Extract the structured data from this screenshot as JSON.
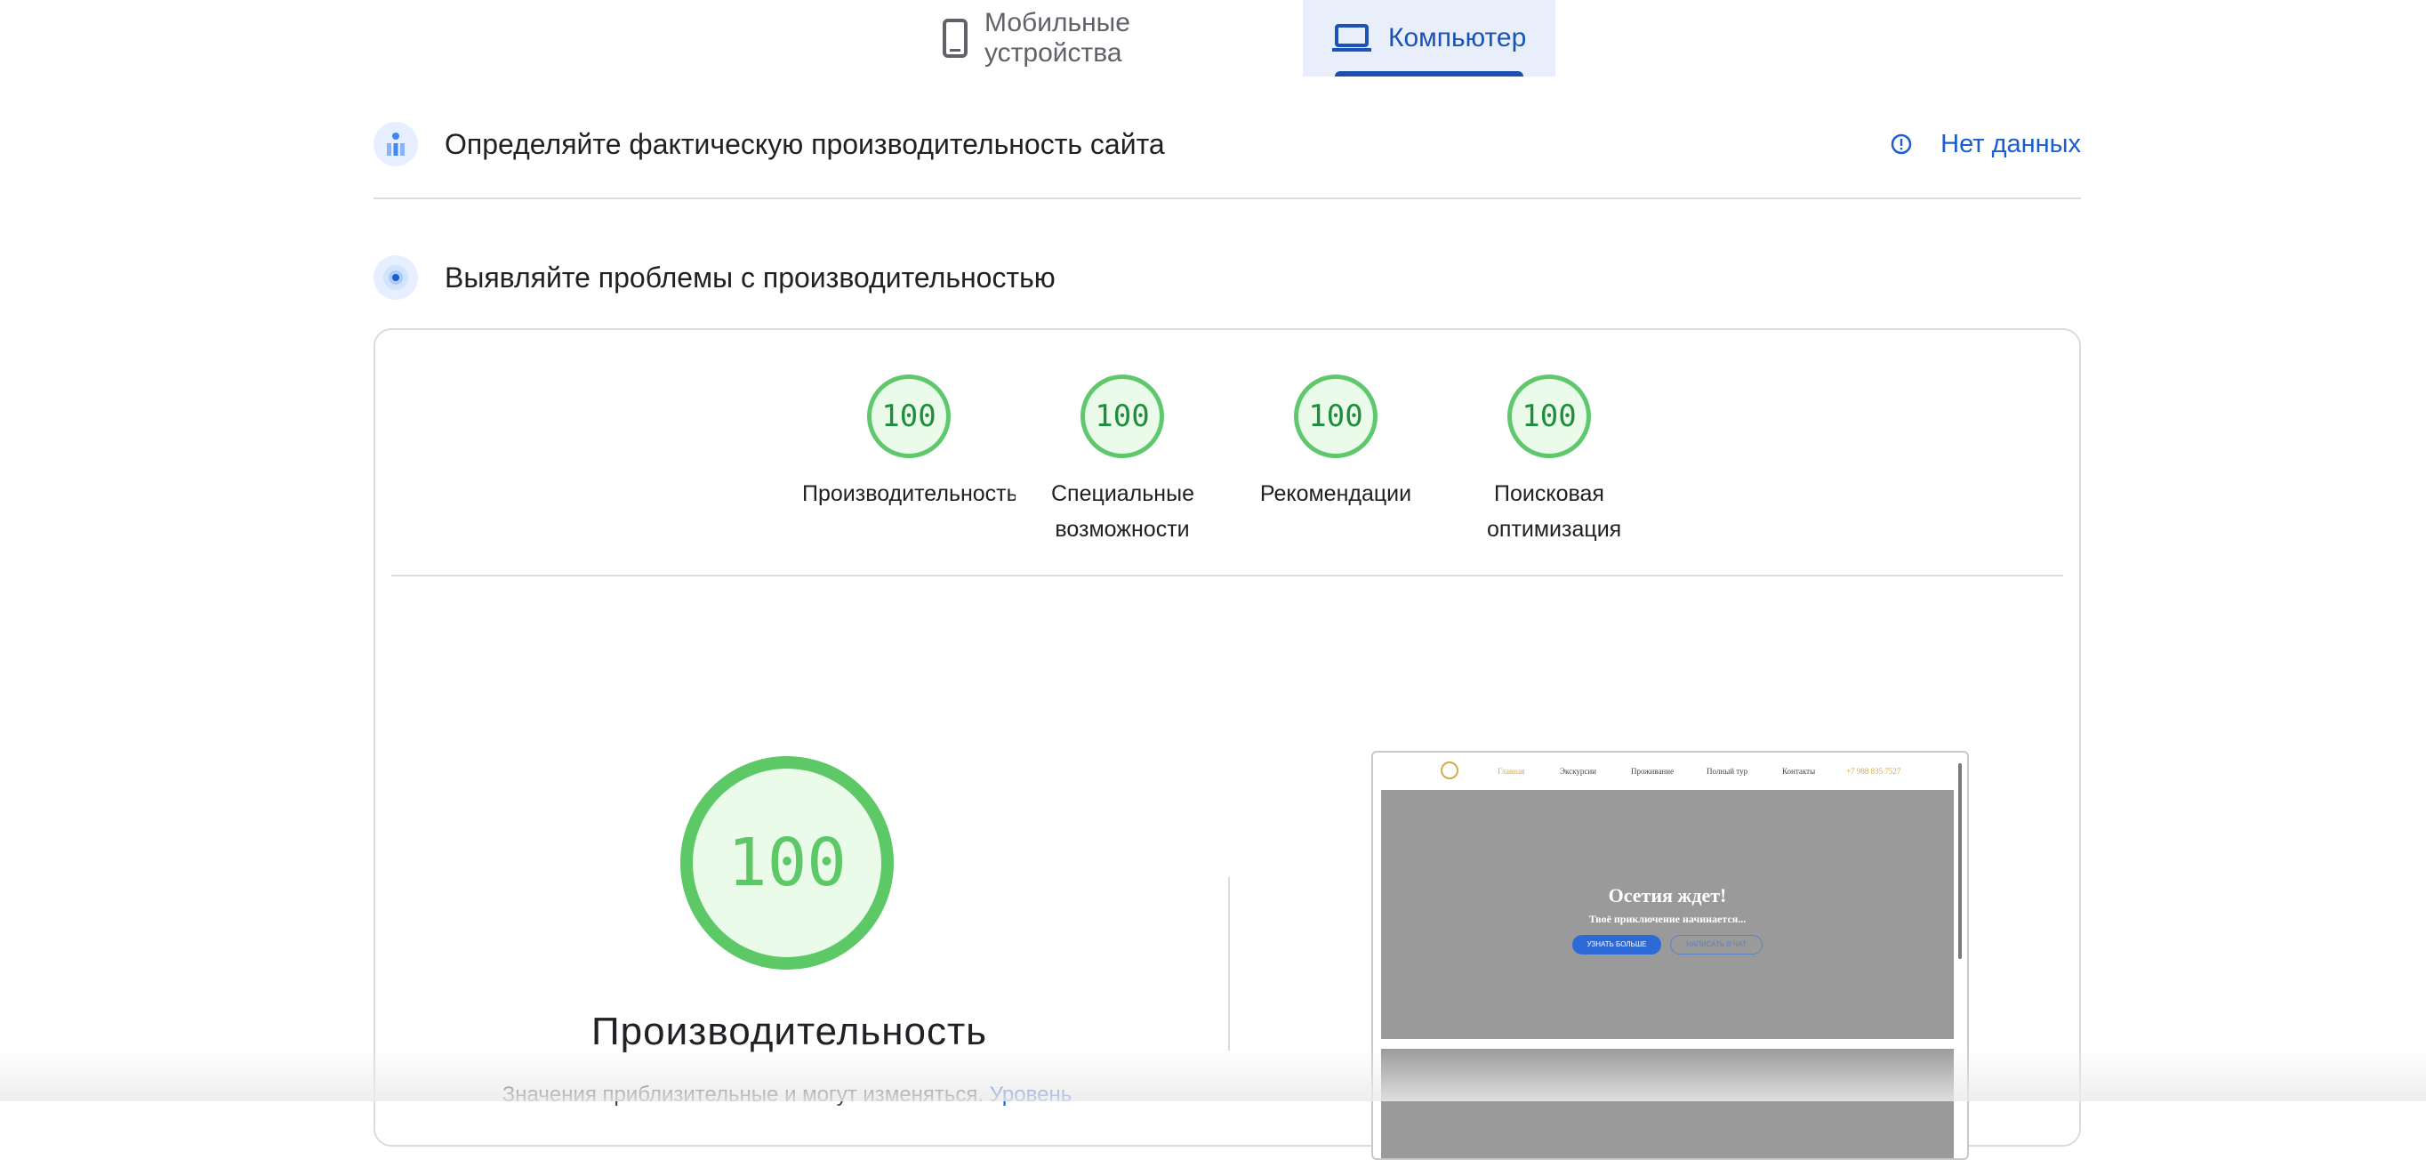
{
  "tabs": [
    {
      "label": "Мобильные устройства",
      "icon": "phone-icon"
    },
    {
      "label": "Компьютер",
      "icon": "laptop-icon",
      "active": true
    }
  ],
  "field_section": {
    "title": "Определяйте фактическую производительность сайта",
    "status": "Нет данных",
    "icon": "field-data-icon",
    "status_icon": "info-icon"
  },
  "lab_section": {
    "title": "Выявляйте проблемы с производительностью",
    "icon": "lab-data-icon"
  },
  "categories": [
    {
      "score": "100",
      "label": "Производительность"
    },
    {
      "score": "100",
      "label": "Специальные возможности"
    },
    {
      "score": "100",
      "label": "Рекомендации"
    },
    {
      "score": "100",
      "label": "Поисковая оптимизация"
    }
  ],
  "performance": {
    "score": "100",
    "title": "Производительность",
    "note": "Значения приблизительные и могут изменяться.",
    "link": "Уровень"
  },
  "screenshot": {
    "nav": [
      "Главная",
      "Экскурсии",
      "Проживание",
      "Полный тур",
      "Контакты",
      "+7 988 835 7527"
    ],
    "hero_title": "Осетия ждет!",
    "hero_subtitle": "Твоё приключение начинается...",
    "button_primary": "УЗНАТЬ БОЛЬШЕ",
    "button_secondary": "НАПИСАТЬ В ЧАТ"
  },
  "colors": {
    "accent": "#1a5dd0",
    "pass": "#5cc866",
    "tab_active_bg": "#e8eefa"
  }
}
